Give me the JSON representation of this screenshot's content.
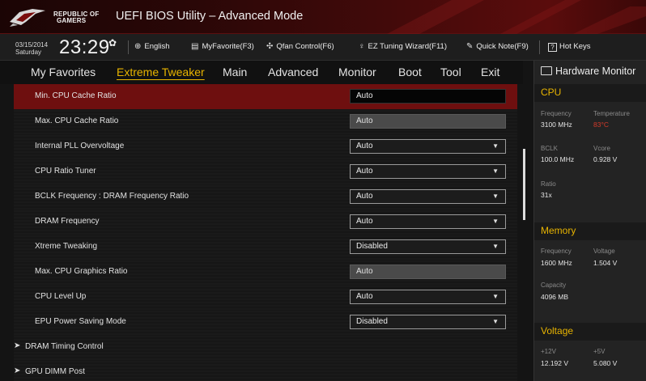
{
  "header": {
    "logo_text_line1": "REPUBLIC OF",
    "logo_text_line2": "GAMERS",
    "app_title": "UEFI BIOS Utility – Advanced Mode"
  },
  "toolbar": {
    "date": "03/15/2014",
    "day": "Saturday",
    "time": "23:29",
    "language": "English",
    "myfavorite": "MyFavorite(F3)",
    "qfan": "Qfan Control(F6)",
    "ez_tuning": "EZ Tuning Wizard(F11)",
    "quick_note": "Quick Note(F9)",
    "hot_keys": "Hot Keys",
    "hot_keys_glyph": "?"
  },
  "menu": {
    "items": [
      "My Favorites",
      "Extreme Tweaker",
      "Main",
      "Advanced",
      "Monitor",
      "Boot",
      "Tool",
      "Exit"
    ],
    "active": "Extreme Tweaker"
  },
  "settings": [
    {
      "label": "Min. CPU Cache Ratio",
      "value": "Auto",
      "type": "text",
      "selected": true
    },
    {
      "label": "Max. CPU Cache Ratio",
      "value": "Auto",
      "type": "readonly"
    },
    {
      "label": "Internal PLL Overvoltage",
      "value": "Auto",
      "type": "dropdown"
    },
    {
      "label": "CPU Ratio Tuner",
      "value": "Auto",
      "type": "dropdown"
    },
    {
      "label": "BCLK Frequency : DRAM Frequency Ratio",
      "value": "Auto",
      "type": "dropdown"
    },
    {
      "label": "DRAM Frequency",
      "value": "Auto",
      "type": "dropdown"
    },
    {
      "label": "Xtreme Tweaking",
      "value": "Disabled",
      "type": "dropdown"
    },
    {
      "label": "Max. CPU Graphics Ratio",
      "value": "Auto",
      "type": "readonly"
    },
    {
      "label": "CPU Level Up",
      "value": "Auto",
      "type": "dropdown"
    },
    {
      "label": "EPU Power Saving Mode",
      "value": "Disabled",
      "type": "dropdown"
    },
    {
      "label": "DRAM Timing Control",
      "type": "submenu"
    },
    {
      "label": "GPU DIMM Post",
      "type": "submenu"
    }
  ],
  "hardware_monitor": {
    "title": "Hardware Monitor",
    "cpu": {
      "section": "CPU",
      "frequency_label": "Frequency",
      "frequency": "3100 MHz",
      "temperature_label": "Temperature",
      "temperature": "83°C",
      "bclk_label": "BCLK",
      "bclk": "100.0 MHz",
      "vcore_label": "Vcore",
      "vcore": "0.928 V",
      "ratio_label": "Ratio",
      "ratio": "31x"
    },
    "memory": {
      "section": "Memory",
      "frequency_label": "Frequency",
      "frequency": "1600 MHz",
      "voltage_label": "Voltage",
      "voltage": "1.504 V",
      "capacity_label": "Capacity",
      "capacity": "4096 MB"
    },
    "voltage": {
      "section": "Voltage",
      "v12_label": "+12V",
      "v12": "12.192 V",
      "v5_label": "+5V",
      "v5": "5.080 V"
    }
  },
  "colors": {
    "accent_gold": "#e8b400",
    "selected_row": "#6e0f0f",
    "warning_red": "#d23a2a",
    "header_red": "#5a0c0c"
  },
  "icons": {
    "logo": "rog-eye-icon",
    "settings": "gear-icon",
    "language": "globe-icon",
    "favorite": "favorite-list-icon",
    "qfan": "fan-icon",
    "ez_tuning": "bulb-icon",
    "quick_note": "note-icon",
    "hot_keys": "help-icon",
    "hardware_monitor": "monitor-icon",
    "dropdown": "caret-down-icon",
    "submenu": "chevron-right-icon"
  }
}
